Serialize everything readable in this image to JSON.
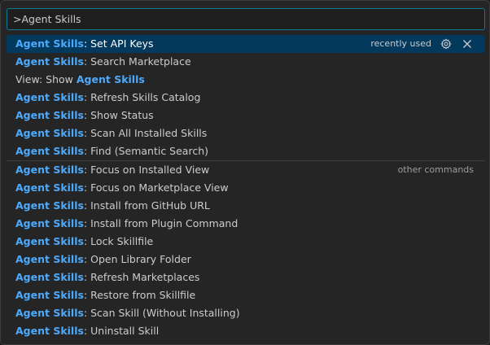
{
  "search": {
    "value": ">Agent Skills"
  },
  "badges": {
    "recently_used": "recently used",
    "other_commands": "other commands"
  },
  "highlight": "Agent Skills",
  "commands": [
    {
      "prefix": "",
      "highlight": "Agent Skills",
      "suffix": ": Set API Keys"
    },
    {
      "prefix": "",
      "highlight": "Agent Skills",
      "suffix": ": Search Marketplace"
    },
    {
      "prefix": "View: Show ",
      "highlight": "Agent Skills",
      "suffix": ""
    },
    {
      "prefix": "",
      "highlight": "Agent Skills",
      "suffix": ": Refresh Skills Catalog"
    },
    {
      "prefix": "",
      "highlight": "Agent Skills",
      "suffix": ": Show Status"
    },
    {
      "prefix": "",
      "highlight": "Agent Skills",
      "suffix": ": Scan All Installed Skills"
    },
    {
      "prefix": "",
      "highlight": "Agent Skills",
      "suffix": ": Find (Semantic Search)"
    },
    {
      "prefix": "",
      "highlight": "Agent Skills",
      "suffix": ": Focus on Installed View"
    },
    {
      "prefix": "",
      "highlight": "Agent Skills",
      "suffix": ": Focus on Marketplace View"
    },
    {
      "prefix": "",
      "highlight": "Agent Skills",
      "suffix": ": Install from GitHub URL"
    },
    {
      "prefix": "",
      "highlight": "Agent Skills",
      "suffix": ": Install from Plugin Command"
    },
    {
      "prefix": "",
      "highlight": "Agent Skills",
      "suffix": ": Lock Skillfile"
    },
    {
      "prefix": "",
      "highlight": "Agent Skills",
      "suffix": ": Open Library Folder"
    },
    {
      "prefix": "",
      "highlight": "Agent Skills",
      "suffix": ": Refresh Marketplaces"
    },
    {
      "prefix": "",
      "highlight": "Agent Skills",
      "suffix": ": Restore from Skillfile"
    },
    {
      "prefix": "",
      "highlight": "Agent Skills",
      "suffix": ": Scan Skill (Without Installing)"
    },
    {
      "prefix": "",
      "highlight": "Agent Skills",
      "suffix": ": Uninstall Skill"
    }
  ],
  "icons": {
    "configure": "gear-icon",
    "remove": "close-icon"
  },
  "colors": {
    "highlight": "#4daafc",
    "selected_bg": "#04395e",
    "focus_border": "#0e7a9a"
  }
}
